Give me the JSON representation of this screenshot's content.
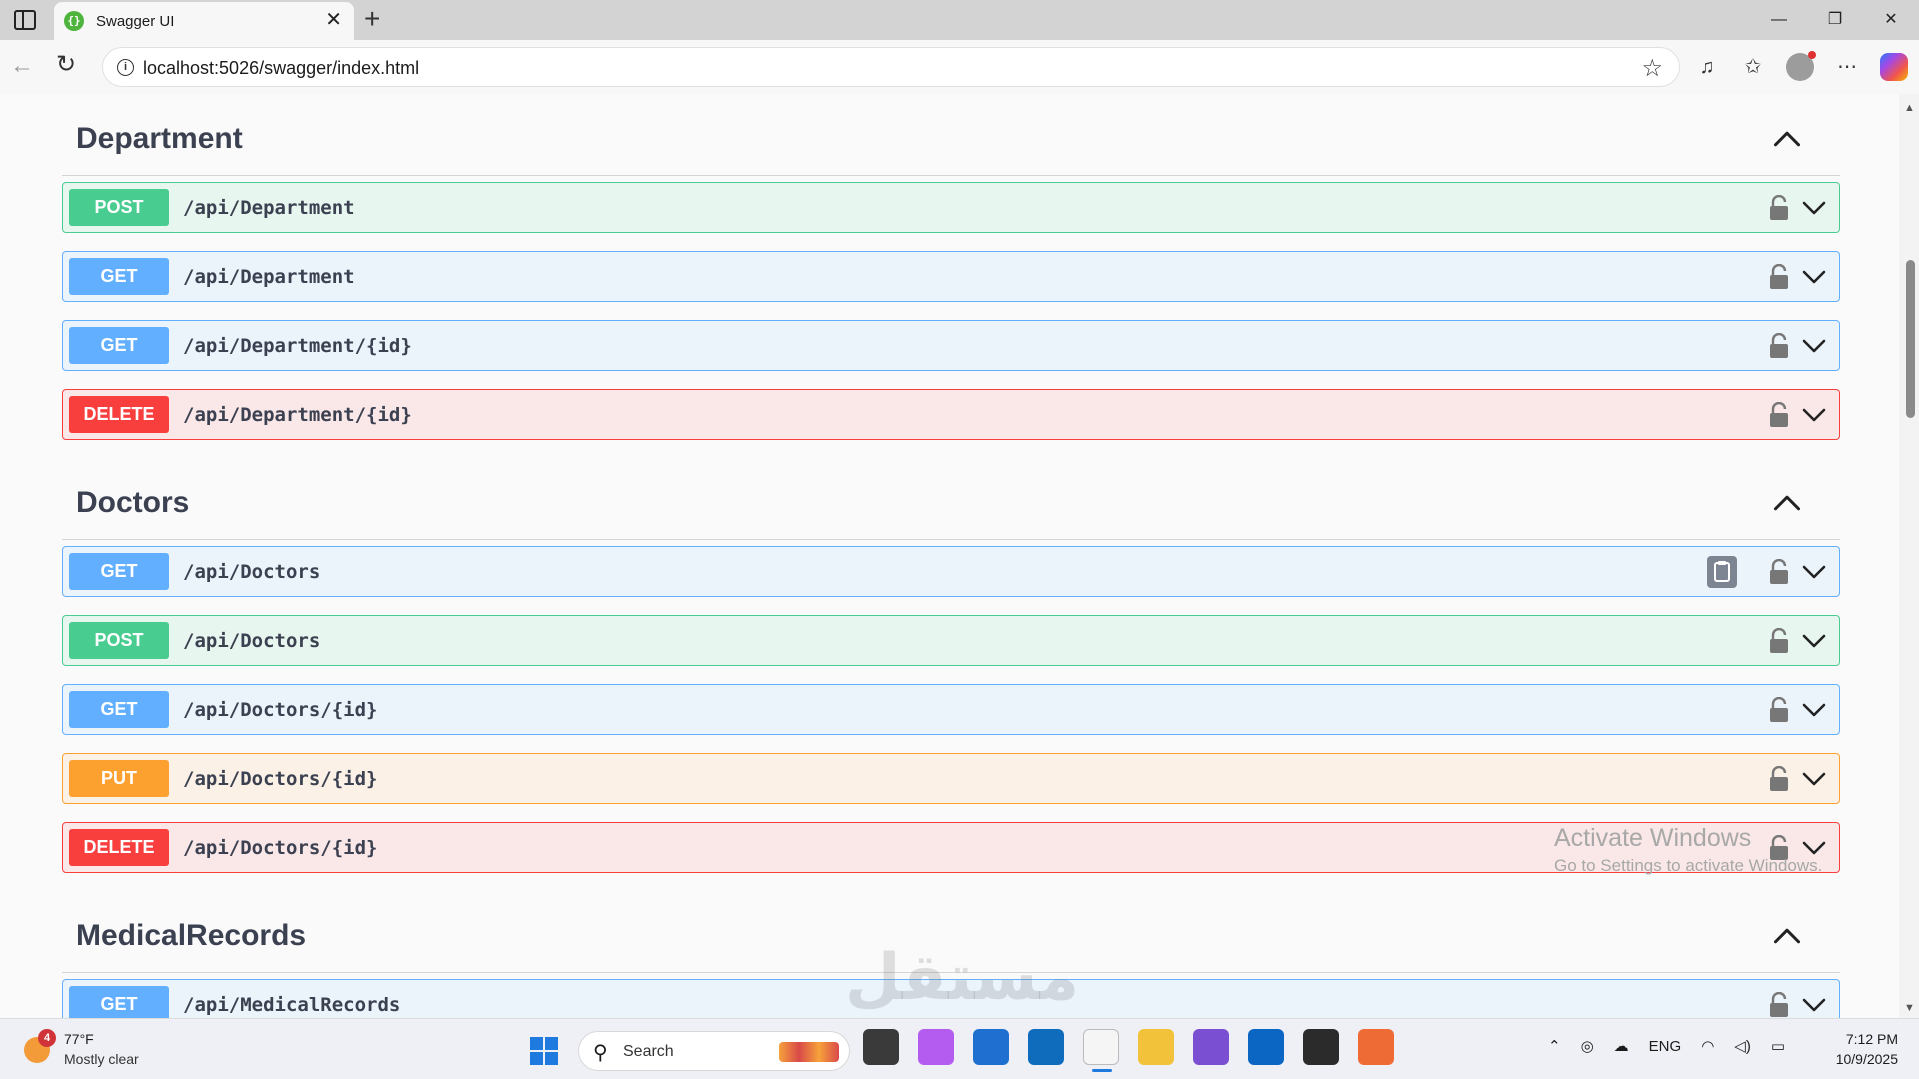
{
  "browser": {
    "tab_title": "Swagger UI",
    "favicon_text": "{}",
    "tab_close_glyph": "✕",
    "new_tab_glyph": "+",
    "url": "localhost:5026/swagger/index.html",
    "window_controls": [
      "—",
      "❐",
      "✕"
    ]
  },
  "sections": [
    {
      "title": "Department",
      "operations": [
        {
          "method": "POST",
          "path": "/api/Department",
          "kind": "post"
        },
        {
          "method": "GET",
          "path": "/api/Department",
          "kind": "get"
        },
        {
          "method": "GET",
          "path": "/api/Department/{id}",
          "kind": "get"
        },
        {
          "method": "DELETE",
          "path": "/api/Department/{id}",
          "kind": "delete"
        }
      ]
    },
    {
      "title": "Doctors",
      "operations": [
        {
          "method": "GET",
          "path": "/api/Doctors",
          "kind": "get",
          "copy_button": true
        },
        {
          "method": "POST",
          "path": "/api/Doctors",
          "kind": "post"
        },
        {
          "method": "GET",
          "path": "/api/Doctors/{id}",
          "kind": "get"
        },
        {
          "method": "PUT",
          "path": "/api/Doctors/{id}",
          "kind": "put"
        },
        {
          "method": "DELETE",
          "path": "/api/Doctors/{id}",
          "kind": "delete"
        }
      ]
    },
    {
      "title": "MedicalRecords",
      "operations": [
        {
          "method": "GET",
          "path": "/api/MedicalRecords",
          "kind": "get"
        }
      ]
    }
  ],
  "colors": {
    "get": "#61affe",
    "post": "#49cc90",
    "put": "#fca130",
    "delete": "#f93e3e"
  },
  "watermark": {
    "title": "Activate Windows",
    "subtitle": "Go to Settings to activate Windows.",
    "logo_text": "مستقل"
  },
  "taskbar": {
    "weather_temp": "77°F",
    "weather_desc": "Mostly clear",
    "weather_badge": "4",
    "search_placeholder": "Search",
    "language": "ENG",
    "time": "7:12 PM",
    "date": "10/9/2025",
    "apps": [
      "task-view-icon",
      "copilot-icon",
      "store-icon",
      "outlook-icon",
      "notepad-icon",
      "file-explorer-icon",
      "visual-studio-icon",
      "linkedin-icon",
      "terminal-icon",
      "postman-icon"
    ]
  }
}
